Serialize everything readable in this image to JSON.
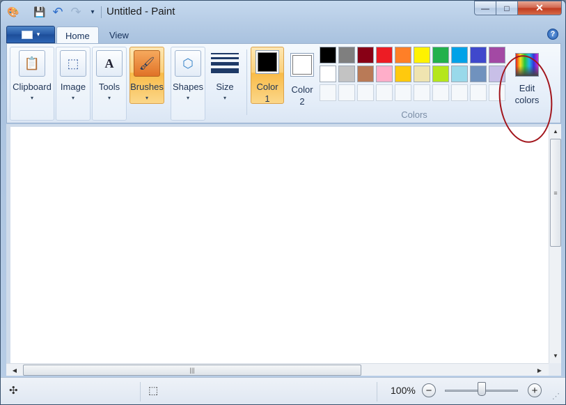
{
  "window": {
    "title": "Untitled - Paint"
  },
  "quick_access": [
    "paint-app-icon",
    "save-icon",
    "undo-icon",
    "redo-icon",
    "customize-dropdown-icon"
  ],
  "caption_buttons": {
    "minimize": "—",
    "maximize": "□",
    "close": "✕"
  },
  "tabs": [
    {
      "label": "Home",
      "active": true
    },
    {
      "label": "View",
      "active": false
    }
  ],
  "help": "?",
  "ribbon": {
    "tools": [
      {
        "id": "clipboard",
        "label": "Clipboard",
        "icon": "clipboard-icon",
        "glyph": "📋"
      },
      {
        "id": "image",
        "label": "Image",
        "icon": "image-select-icon",
        "glyph": "⬚"
      },
      {
        "id": "tools",
        "label": "Tools",
        "icon": "tools-icon",
        "glyph": "A"
      },
      {
        "id": "brushes",
        "label": "Brushes",
        "icon": "brush-icon",
        "glyph": "🖌"
      },
      {
        "id": "shapes",
        "label": "Shapes",
        "icon": "shapes-icon",
        "glyph": "⬡"
      },
      {
        "id": "size",
        "label": "Size",
        "icon": "size-lines-icon"
      }
    ],
    "dropdown_glyph": "▾",
    "color1": {
      "label_line1": "Color",
      "label_line2": "1",
      "value": "#000000"
    },
    "color2": {
      "label_line1": "Color",
      "label_line2": "2",
      "value": "#ffffff"
    },
    "palette_rows": [
      [
        "#000000",
        "#7f7f7f",
        "#880015",
        "#ed1c24",
        "#ff7f27",
        "#fff200",
        "#22b14c",
        "#00a2e8",
        "#3f48cc",
        "#a349a4"
      ],
      [
        "#ffffff",
        "#c3c3c3",
        "#b97a57",
        "#ffaec9",
        "#ffc90e",
        "#efe4b0",
        "#b5e61d",
        "#99d9ea",
        "#7092be",
        "#c8bfe7"
      ],
      [
        "",
        "",
        "",
        "",
        "",
        "",
        "",
        "",
        "",
        ""
      ]
    ],
    "colors_group_label": "Colors",
    "edit_colors": {
      "line1": "Edit",
      "line2": "colors",
      "icon": "edit-colors-icon"
    }
  },
  "status": {
    "zoom": "100%",
    "zoom_level_fraction": 0.5,
    "zoom_out": "−",
    "zoom_in": "+",
    "move_icon": "✣",
    "selection_icon": "⬚",
    "resize_grip": "⋰"
  },
  "scrollbars": {
    "up": "▲",
    "down": "▼",
    "left": "◀",
    "right": "▶",
    "grip_v": "≡",
    "grip_h": "|||"
  }
}
